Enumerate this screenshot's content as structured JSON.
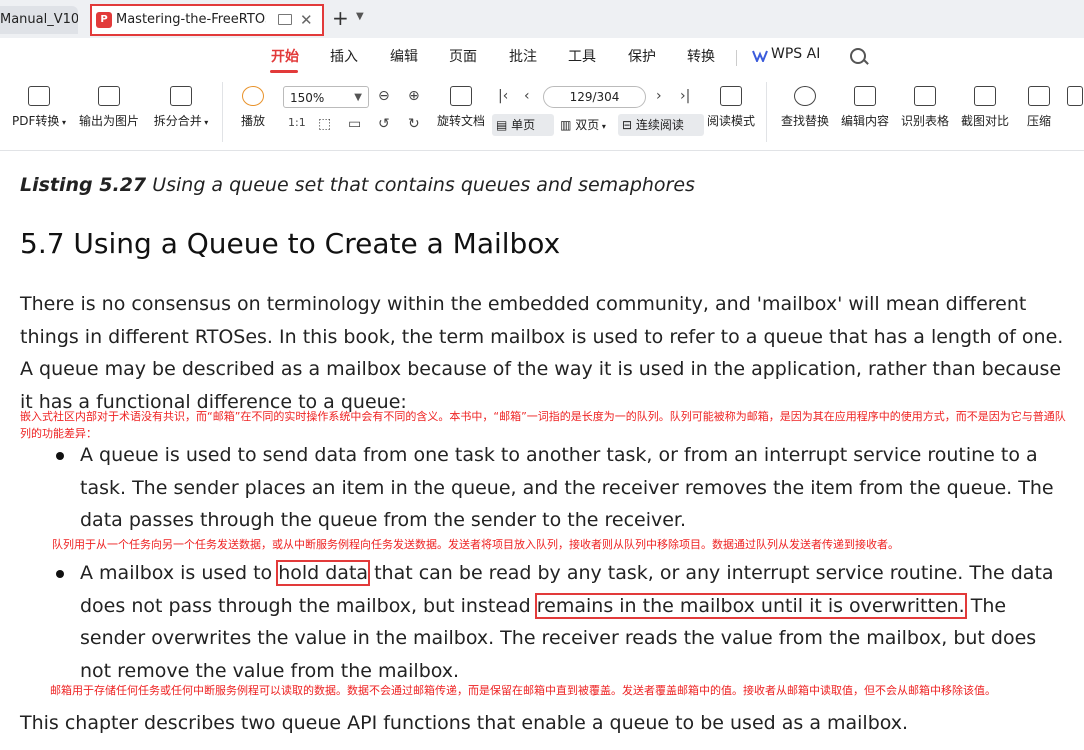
{
  "tabs": {
    "inactive_label": "Manual_V10",
    "active_label": "Mastering-the-FreeRTOS-R",
    "new_tab_symbol": "+",
    "menu_symbol": "⌄"
  },
  "menu": {
    "items": [
      "开始",
      "插入",
      "编辑",
      "页面",
      "批注",
      "工具",
      "保护",
      "转换"
    ],
    "wps_ai": "WPS AI"
  },
  "toolbar": {
    "pdf_convert": "PDF转换",
    "export_image": "输出为图片",
    "split_merge": "拆分合并",
    "play": "播放",
    "zoom": "150%",
    "rotate_doc": "旋转文档",
    "page_indicator": "129/304",
    "single_page": "单页",
    "double_page": "双页",
    "continuous": "连续阅读",
    "reading_mode": "阅读模式",
    "find_replace": "查找替换",
    "edit_content": "编辑内容",
    "recognize_table": "识别表格",
    "screenshot_compare": "截图对比",
    "compress": "压缩"
  },
  "doc": {
    "listing_bold": "Listing 5.27",
    "listing_rest": " Using a queue set that contains queues and semaphores",
    "heading": "5.7 Using a Queue to Create a Mailbox",
    "para1": "There is no consensus on terminology within the embedded community, and 'mailbox' will mean different things in different RTOSes. In this book, the term mailbox is used to refer to a queue that has a length of one. A queue may be described as a mailbox because of the way it is used in the application, rather than because it has a functional difference to a queue:",
    "cn1": "嵌入式社区内部对于术语没有共识，而“邮箱”在不同的实时操作系统中会有不同的含义。本书中，“邮箱”一词指的是长度为一的队列。队列可能被称为邮箱，是因为其在应用程序中的使用方式，而不是因为它与普通队列的功能差异：",
    "bullet1": "A queue is used to send data from one task to another task, or from an interrupt service routine to a task. The sender places an item in the queue, and the receiver removes the item from the queue. The data passes through the queue from the sender to the receiver.",
    "cn2": "队列用于从一个任务向另一个任务发送数据，或从中断服务例程向任务发送数据。发送者将项目放入队列，接收者则从队列中移除项目。数据通过队列从发送者传递到接收者。",
    "bullet2_a": "A mailbox is used to ",
    "bullet2_hl1": "hold data",
    "bullet2_b": " that can be read by any task, or any interrupt service routine. The data does not pass through the mailbox, but instead ",
    "bullet2_hl2": "remains in the mailbox until it is overwritten.",
    "bullet2_c": " The sender overwrites the value in the mailbox. The receiver reads the value from the mailbox, but does not remove the value from the mailbox.",
    "cn3": "邮箱用于存储任何任务或任何中断服务例程可以读取的数据。数据不会通过邮箱传递，而是保留在邮箱中直到被覆盖。发送者覆盖邮箱中的值。接收者从邮箱中读取值，但不会从邮箱中移除该值。",
    "last": "This chapter describes two queue API functions that enable a queue to be used as a mailbox."
  }
}
